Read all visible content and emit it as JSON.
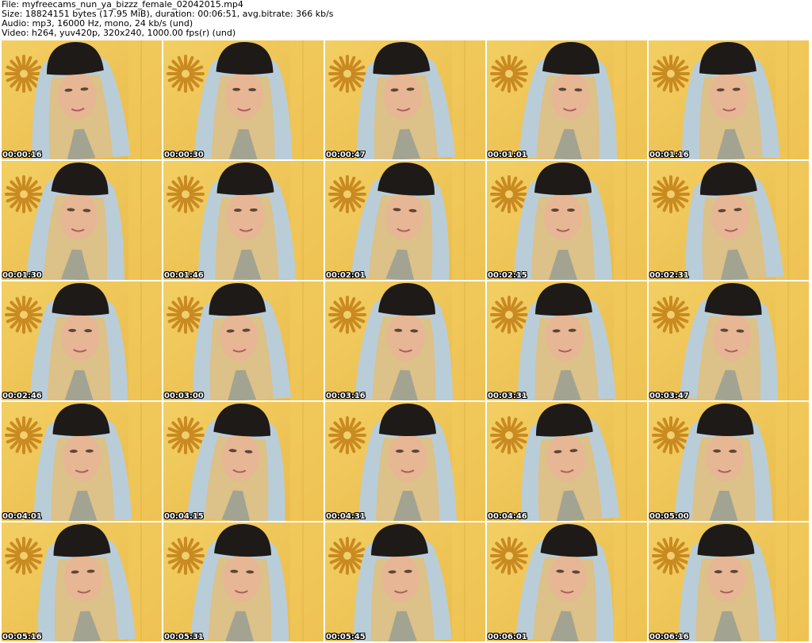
{
  "header": {
    "file": "File: myfreecams_nun_ya_bizzz_female_02042015.mp4",
    "size": "Size: 18824151 bytes (17.95 MiB), duration: 00:06:51, avg.bitrate: 366 kb/s",
    "audio": "Audio: mp3, 16000 Hz, mono, 24 kb/s (und)",
    "video": "Video: h264, yuv420p, 320x240, 1000.00 fps(r) (und)"
  },
  "thumbnails": [
    {
      "time": "00:00:16"
    },
    {
      "time": "00:00:30"
    },
    {
      "time": "00:00:47"
    },
    {
      "time": "00:01:01"
    },
    {
      "time": "00:01:16"
    },
    {
      "time": "00:01:30"
    },
    {
      "time": "00:01:46"
    },
    {
      "time": "00:02:01"
    },
    {
      "time": "00:02:15"
    },
    {
      "time": "00:02:31"
    },
    {
      "time": "00:02:46"
    },
    {
      "time": "00:03:00"
    },
    {
      "time": "00:03:16"
    },
    {
      "time": "00:03:31"
    },
    {
      "time": "00:03:47"
    },
    {
      "time": "00:04:01"
    },
    {
      "time": "00:04:15"
    },
    {
      "time": "00:04:31"
    },
    {
      "time": "00:04:46"
    },
    {
      "time": "00:05:00"
    },
    {
      "time": "00:05:16"
    },
    {
      "time": "00:05:31"
    },
    {
      "time": "00:05:45"
    },
    {
      "time": "00:06:01"
    },
    {
      "time": "00:06:16"
    }
  ],
  "colors": {
    "page_bg": "#ffffff",
    "wall": "#e9b94a",
    "hood": "#b9cdd8",
    "beanie": "#1e1a18",
    "hair": "#dcc188",
    "skin": "#e7b694",
    "sun": "#c98a22"
  }
}
